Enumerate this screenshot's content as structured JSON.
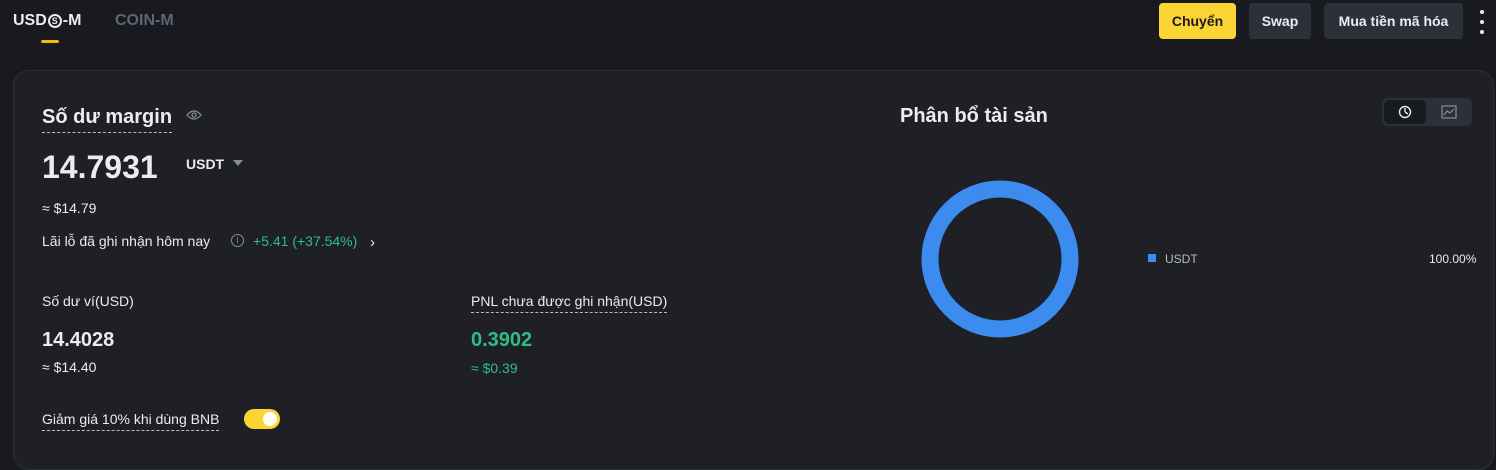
{
  "tabs": [
    {
      "label_pre": "USD",
      "label_mark": "S",
      "label_post": "-M"
    },
    {
      "label": "COIN-M"
    }
  ],
  "actions": {
    "transfer": "Chuyển",
    "swap": "Swap",
    "buy": "Mua tiền mã hóa"
  },
  "margin": {
    "title": "Số dư margin",
    "value": "14.7931",
    "unit": "USDT",
    "approx": "≈ $14.79",
    "pnl_today_label": "Lãi lỗ đã ghi nhận hôm nay",
    "pnl_today_value": "+5.41 (+37.54%)",
    "pnl_chevron": "›"
  },
  "wallet": {
    "label": "Số dư ví(USD)",
    "value": "14.4028",
    "approx": "≈ $14.40"
  },
  "unrealized": {
    "label": "PNL chưa được ghi nhận(USD)",
    "value": "0.3902",
    "approx": "≈ $0.39"
  },
  "bnb_discount": {
    "label": "Giảm giá 10% khi dùng BNB",
    "enabled": true
  },
  "allocation": {
    "title": "Phân bổ tài sản",
    "items": [
      {
        "name": "USDT",
        "percent": "100.00%",
        "color": "#3c8cf0",
        "share": 1.0
      }
    ]
  },
  "colors": {
    "accent": "#fcd535",
    "positive": "#2ebd85",
    "chart_blue": "#3c8cf0"
  },
  "icons": [
    "eye-icon",
    "info-icon",
    "chevron-right-icon",
    "caret-down-icon",
    "pie-chart-icon",
    "line-chart-icon",
    "more-vertical-icon"
  ]
}
